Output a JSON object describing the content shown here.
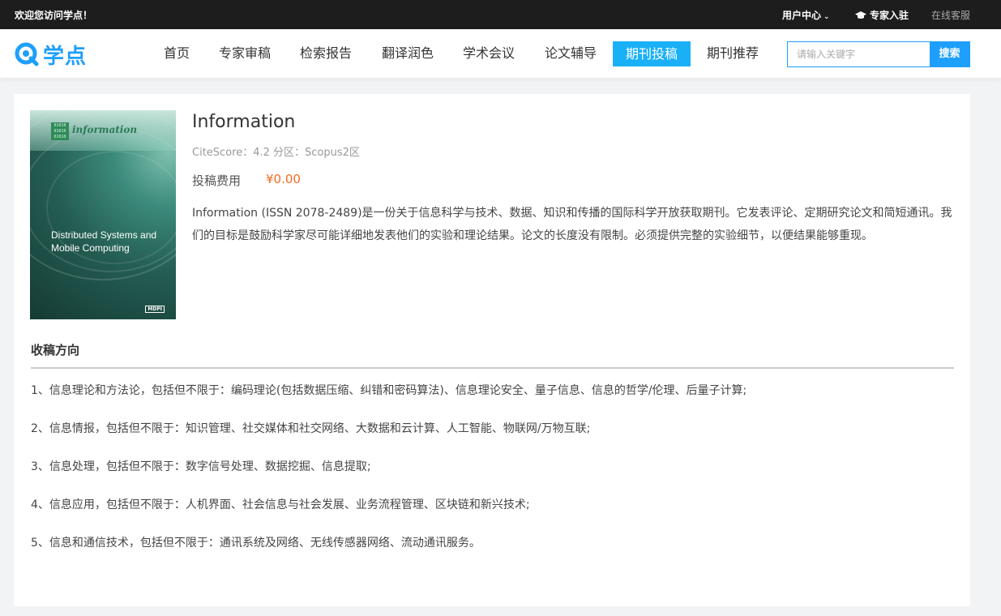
{
  "topbar": {
    "welcome": "欢迎您访问学点！",
    "user_center": "用户中心",
    "expert_join": "专家入驻",
    "online_service": "在线客服"
  },
  "header": {
    "logo_text": "学点",
    "nav": [
      {
        "label": "首页"
      },
      {
        "label": "专家审稿"
      },
      {
        "label": "检索报告"
      },
      {
        "label": "翻译润色"
      },
      {
        "label": "学术会议"
      },
      {
        "label": "论文辅导"
      },
      {
        "label": "期刊投稿",
        "active": true
      },
      {
        "label": "期刊推荐"
      }
    ],
    "search": {
      "placeholder": "请输入关键字",
      "button": "搜索"
    }
  },
  "journal": {
    "cover": {
      "journal_name": "information",
      "title": "Distributed Systems and Mobile Computing",
      "logo_bits": "01010 01010 01010",
      "publisher": "MDPI"
    },
    "title": "Information",
    "citescore": "CiteScore：4.2 分区：Scopus2区",
    "fee_label": "投稿费用",
    "fee_value": "¥0.00",
    "description": "Information (ISSN 2078-2489)是一份关于信息科学与技术、数据、知识和传播的国际科学开放获取期刊。它发表评论、定期研究论文和简短通讯。我们的目标是鼓励科学家尽可能详细地发表他们的实验和理论结果。论文的长度没有限制。必须提供完整的实验细节，以便结果能够重现。"
  },
  "directions": {
    "title": "收稿方向",
    "items": [
      "1、信息理论和方法论，包括但不限于：编码理论(包括数据压缩、纠错和密码算法)、信息理论安全、量子信息、信息的哲学/伦理、后量子计算;",
      "2、信息情报，包括但不限于：知识管理、社交媒体和社交网络、大数据和云计算、人工智能、物联网/万物互联;",
      "3、信息处理，包括但不限于：数字信号处理、数据挖掘、信息提取;",
      "4、信息应用，包括但不限于：人机界面、社会信息与社会发展、业务流程管理、区块链和新兴技术;",
      "5、信息和通信技术，包括但不限于：通讯系统及网络、无线传感器网络、流动通讯服务。"
    ]
  },
  "colors": {
    "accent": "#1e9ffb",
    "active_nav": "#1ab0f7",
    "price": "#f56a1e",
    "topbar": "#1d1d1d"
  }
}
